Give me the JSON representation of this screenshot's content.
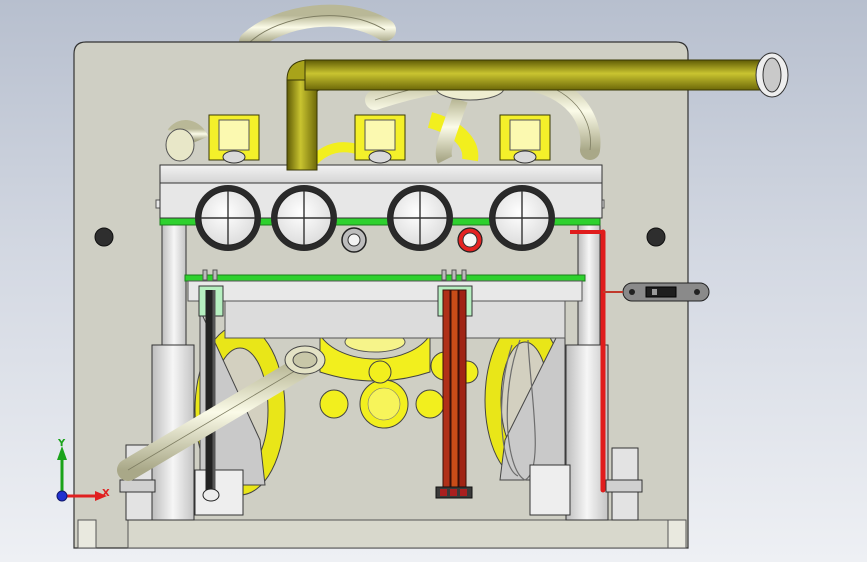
{
  "viewport": {
    "background_top": "#b7bfce",
    "background_bottom": "#eef0f4"
  },
  "model_colors": {
    "base_plate": "#cfcfc4",
    "frame_metal": "#e6e6e6",
    "pipe_olive": "#a8a31a",
    "pipe_cream": "#efeecd",
    "pcb_green": "#2ed12e",
    "fan_yellow": "#f2ef1e",
    "wire_red": "#e01c1c",
    "wire_dark": "#333333"
  },
  "triad": {
    "x_label": "X",
    "y_label": "Y",
    "x_color": "#e02020",
    "y_color": "#1aa31a",
    "z_color": "#2030d0",
    "origin_icon": "triad-origin-icon"
  }
}
